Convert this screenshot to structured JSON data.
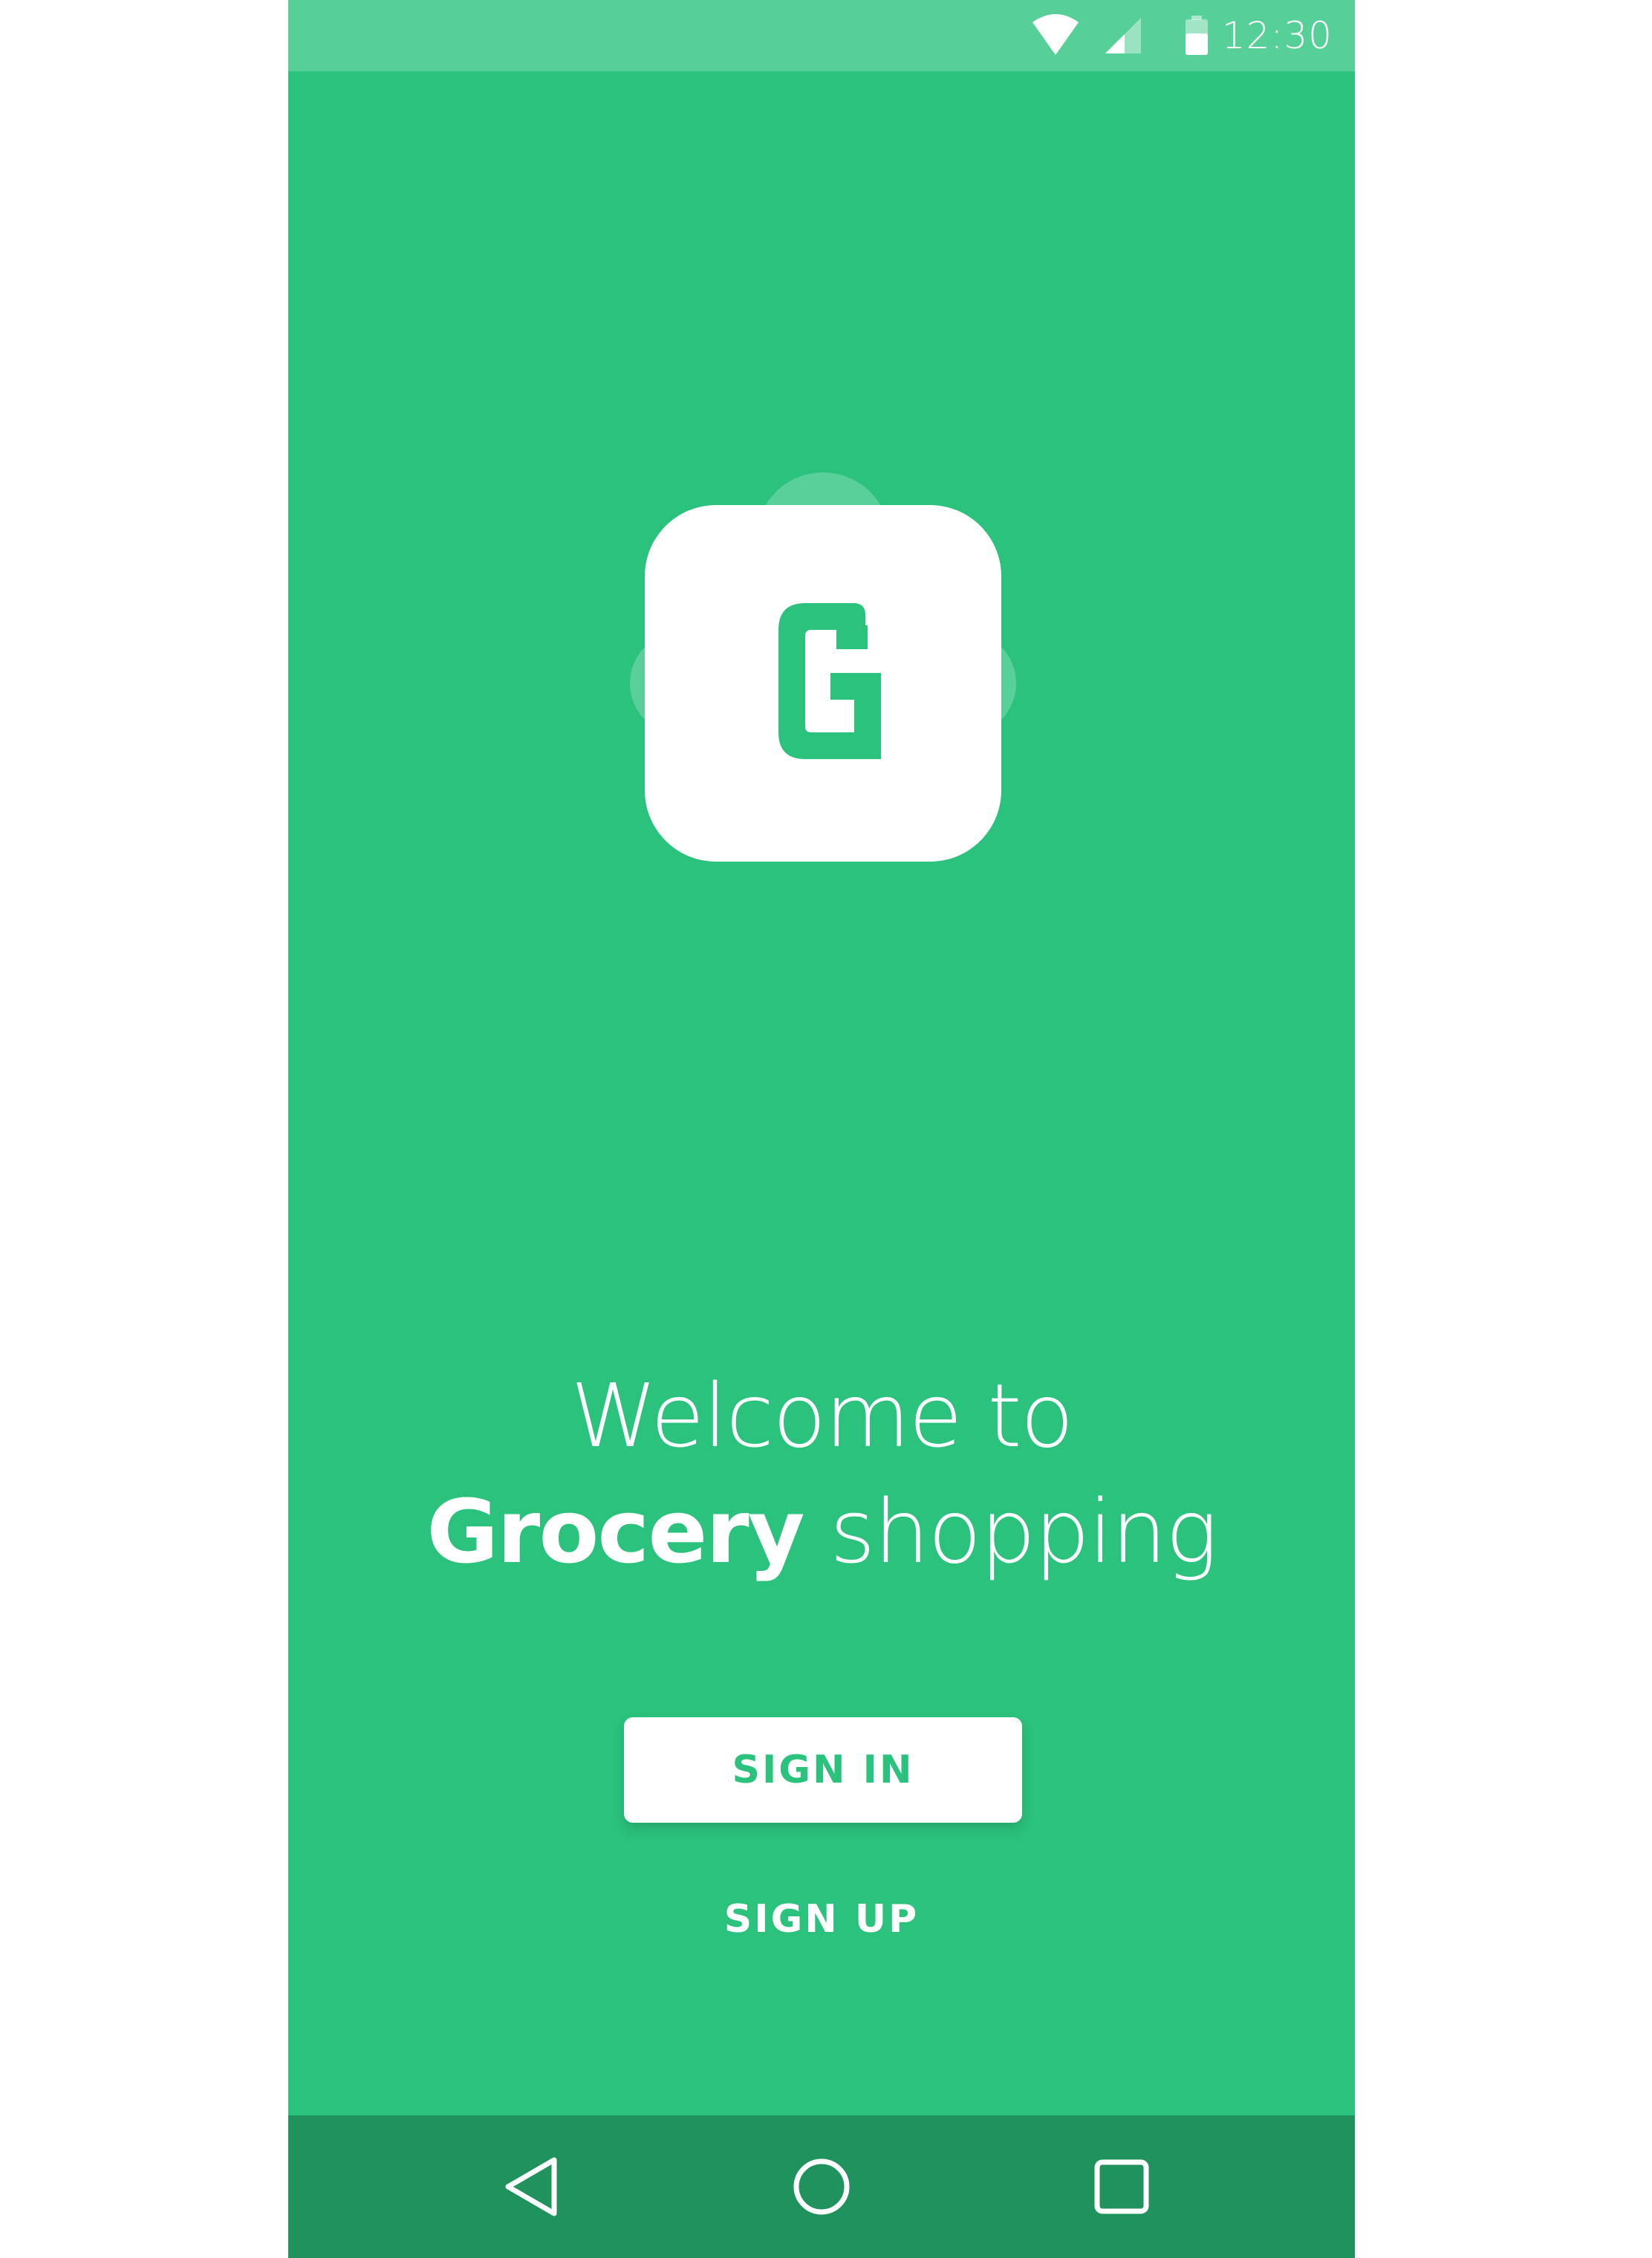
{
  "status_bar": {
    "time": "12:30",
    "icons": [
      "wifi-icon",
      "cell-signal-icon",
      "battery-icon"
    ],
    "color": "#57cf98"
  },
  "logo": {
    "letter": "G",
    "tile_color": "#ffffff",
    "letter_color": "#2bc27d"
  },
  "welcome": {
    "line1": "Welcome to",
    "bold": "Grocery",
    "rest": " shopping"
  },
  "actions": {
    "sign_in_label": "SIGN IN",
    "sign_up_label": "SIGN UP"
  },
  "nav_bar": {
    "icons": [
      "back-icon",
      "home-icon",
      "recents-icon"
    ],
    "color": "#20925e"
  },
  "colors": {
    "background": "#2bc27d",
    "accent": "#2bc27d",
    "text": "#ffffff"
  }
}
